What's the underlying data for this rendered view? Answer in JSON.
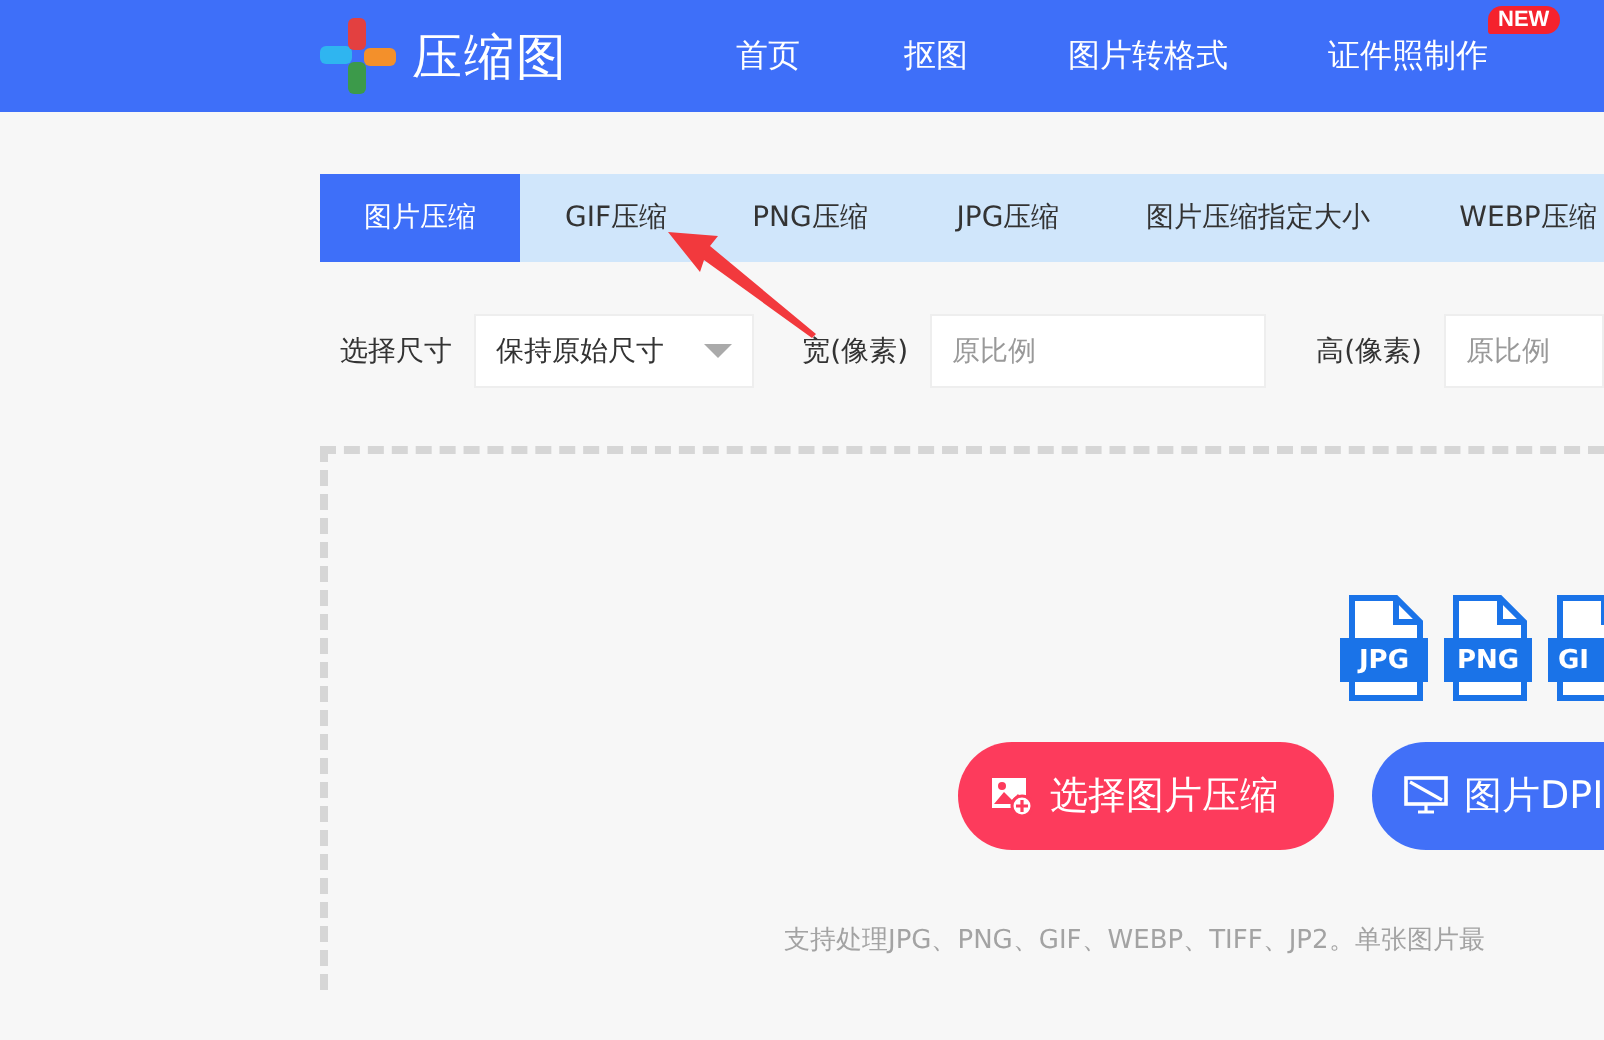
{
  "header": {
    "logo_text": "压缩图",
    "nav": [
      {
        "label": "首页"
      },
      {
        "label": "抠图"
      },
      {
        "label": "图片转格式"
      },
      {
        "label": "证件照制作",
        "badge": "NEW"
      }
    ]
  },
  "tabs": [
    {
      "label": "图片压缩",
      "selected": true
    },
    {
      "label": "GIF压缩",
      "selected": false
    },
    {
      "label": "PNG压缩",
      "selected": false
    },
    {
      "label": "JPG压缩",
      "selected": false
    },
    {
      "label": "图片压缩指定大小",
      "selected": false
    },
    {
      "label": "WEBP压缩",
      "selected": false
    }
  ],
  "options": {
    "size_label": "选择尺寸",
    "size_value": "保持原始尺寸",
    "width_label": "宽(像素)",
    "width_placeholder": "原比例",
    "height_label": "高(像素)",
    "height_placeholder": "原比例"
  },
  "upload": {
    "formats": [
      "JPG",
      "PNG",
      "GI"
    ],
    "buttons": [
      {
        "kind": "upload",
        "label": "选择图片压缩"
      },
      {
        "kind": "dpi",
        "label": "图片DPI"
      }
    ],
    "note": "支持处理JPG、PNG、GIF、WEBP、TIFF、JP2。单张图片最"
  }
}
